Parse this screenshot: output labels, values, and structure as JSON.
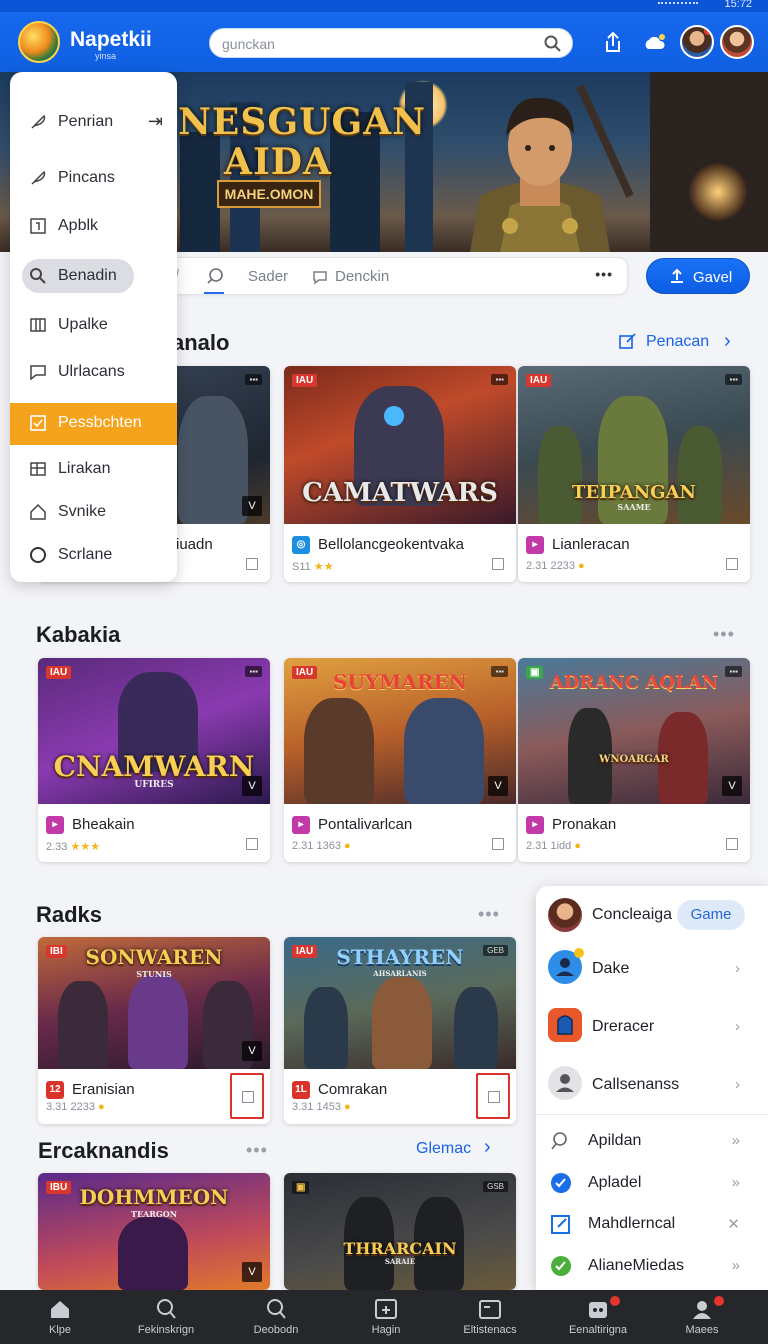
{
  "statusbar": {
    "time": "15:72"
  },
  "header": {
    "brand": "Napetkii",
    "brand_sub": "yinsa",
    "search_placeholder": "gunckan"
  },
  "hero": {
    "title": "NESGUGAN AIDA",
    "badge": "MAHE.OMON"
  },
  "tabs": [
    {
      "label": "Sader"
    },
    {
      "label": "Denckin"
    }
  ],
  "action_button": {
    "label": "Gavel"
  },
  "menu": {
    "items": [
      {
        "label": "Penrian",
        "icon": "feather-icon"
      },
      {
        "label": "Pincans",
        "icon": "feather-icon"
      },
      {
        "label": "Apblk",
        "icon": "bracket-box-icon"
      },
      {
        "label": "Benadin",
        "icon": "search-icon"
      },
      {
        "label": "Upalke",
        "icon": "columns-icon"
      },
      {
        "label": "Ulrlacans",
        "icon": "comment-icon"
      },
      {
        "label": "Pessbchten",
        "icon": "checkbox-icon"
      },
      {
        "label": "Lirakan",
        "icon": "grid-plus-icon"
      },
      {
        "label": "Svnike",
        "icon": "home-icon"
      },
      {
        "label": "Scrlane",
        "icon": "circle-icon"
      }
    ],
    "active_index": 6
  },
  "sections": {
    "s1": {
      "title": "analo",
      "link": "Penacan"
    },
    "s2": {
      "title": "Kabakia"
    },
    "s3": {
      "title": "Radks"
    },
    "s4": {
      "title": "Ercaknandis",
      "link": "Glemac"
    }
  },
  "cards": {
    "c1": {
      "name": "iuadn",
      "v": "V"
    },
    "c2": {
      "art": "CAMATWARS",
      "name": "Bellolancgeokentvaka",
      "sub": "S11",
      "stars": "★★",
      "tag": "IAU"
    },
    "c3": {
      "art": "TEIPANGAN",
      "art_sub": "SAAME",
      "name": "Lianleracan",
      "sub": "2.31 2233",
      "tag": "IAU"
    },
    "c4": {
      "art": "CNAMWARN",
      "art_sub": "UFIRES",
      "name": "Bheakain",
      "sub": "2.33",
      "stars": "★★★",
      "tag": "IAU",
      "v": "V"
    },
    "c5": {
      "art": "SUYMAREN",
      "name": "Pontalivarlcan",
      "sub": "2.31 1363",
      "tag": "IAU",
      "v": "V"
    },
    "c6": {
      "art": "ADRANC AQLAN",
      "art_sub": "WNOARGAR",
      "name": "Pronakan",
      "sub": "2.31 1idd",
      "v": "V"
    },
    "c7": {
      "art": "SONWAREN",
      "art_sub": "STUNIS",
      "name": "Eranisian",
      "sub": "3.31 2233",
      "tag": "IBI",
      "badge": "12",
      "v": "V"
    },
    "c8": {
      "art": "STHAYREN",
      "art_sub": "AHSARLANIS",
      "name": "Comrakan",
      "sub": "3.31 1453",
      "tag": "IAU",
      "badge": "1L",
      "tagr": "GEB"
    },
    "c9": {
      "art": "DOHMMEON",
      "art_sub": "TEARGON",
      "tag": "IBU",
      "v": "V"
    },
    "c10": {
      "art": "THRARCAIN",
      "art_sub": "SARAIE",
      "tagr": "GSB"
    }
  },
  "popup": {
    "items": [
      {
        "label": "Concleaiga",
        "pill": "Game"
      },
      {
        "label": "Dake"
      },
      {
        "label": "Dreracer"
      },
      {
        "label": "Callsenanss"
      },
      {
        "label": "Apildan"
      },
      {
        "label": "Apladel"
      },
      {
        "label": "Mahdlerncal"
      },
      {
        "label": "AlianeMiedas"
      }
    ]
  },
  "bottom_nav": {
    "items": [
      {
        "label": "Klpe",
        "icon": "home-icon"
      },
      {
        "label": "Fekinskrign",
        "icon": "search-icon"
      },
      {
        "label": "Deobodn",
        "icon": "search-icon"
      },
      {
        "label": "Hagin",
        "icon": "calendar-icon"
      },
      {
        "label": "Eltistenacs",
        "icon": "folder-icon"
      },
      {
        "label": "Eenaltirigna",
        "icon": "gamepad-icon"
      },
      {
        "label": "Maees",
        "icon": "profile-icon"
      }
    ]
  },
  "colors": {
    "brand": "#1668ee",
    "active_menu": "#f5a21c",
    "accent_red": "#d9332b",
    "nav_bg": "#26272b"
  }
}
